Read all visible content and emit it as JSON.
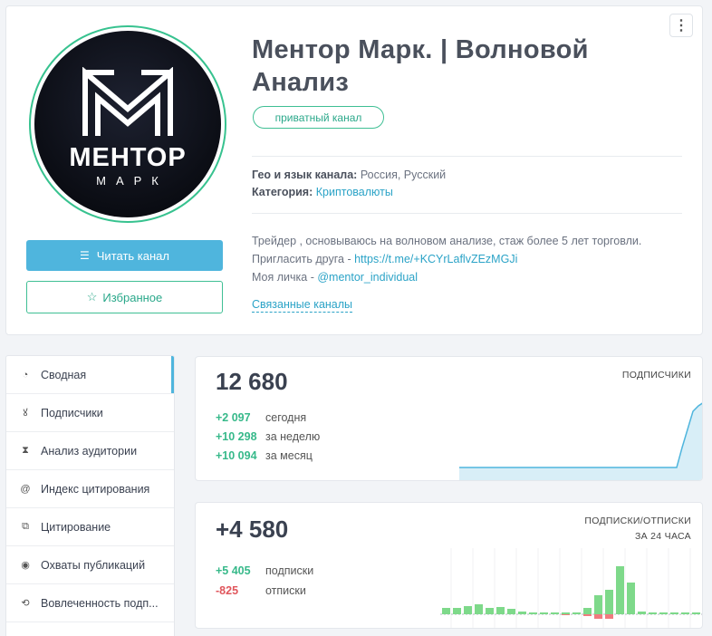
{
  "channel": {
    "title": "Ментор Марк. | Волновой Анализ",
    "badge": "приватный канал",
    "geo_label": "Гео и язык канала:",
    "geo_value": "Россия, Русский",
    "category_label": "Категория:",
    "category_value": "Криптовалюты",
    "desc_line1": "Трейдер , основываюсь на волновом анализе, стаж более 5 лет торговли.",
    "desc_line2_prefix": "Пригласить друга - ",
    "desc_line2_link": "https://t.me/+KCYrLaflvZEzMGJi",
    "desc_line3_prefix": "Моя личка - ",
    "desc_line3_link": "@mentor_individual",
    "related": "Связанные каналы",
    "logo_word": "МЕНТОР",
    "logo_sub": "МАРК"
  },
  "buttons": {
    "read": "Читать канал",
    "favorite": "Избранное",
    "menu_icon": "kebab-icon"
  },
  "sidebar": {
    "items": [
      {
        "label": "Сводная",
        "icon": "pie-icon",
        "active": true
      },
      {
        "label": "Подписчики",
        "icon": "users-icon"
      },
      {
        "label": "Анализ аудитории",
        "icon": "hourglass-icon"
      },
      {
        "label": "Индекс цитирования",
        "icon": "at-icon"
      },
      {
        "label": "Цитирование",
        "icon": "copy-icon"
      },
      {
        "label": "Охваты публикаций",
        "icon": "eye-icon"
      },
      {
        "label": "Вовлеченность подп...",
        "icon": "engagement-icon"
      }
    ]
  },
  "subscribers": {
    "total": "12 680",
    "label": "ПОДПИСЧИКИ",
    "rows": [
      {
        "value": "+2 097",
        "label": "сегодня"
      },
      {
        "value": "+10 298",
        "label": "за неделю"
      },
      {
        "value": "+10 094",
        "label": "за месяц"
      }
    ]
  },
  "subs_unsubs": {
    "total": "+4 580",
    "label1": "ПОДПИСКИ/ОТПИСКИ",
    "label2": "ЗА 24 ЧАСА",
    "rows": [
      {
        "value": "+5 405",
        "label": "подписки"
      },
      {
        "value": "-825",
        "label": "отписки"
      }
    ]
  },
  "colors": {
    "accent": "#4fb5dd",
    "green": "#37c28f",
    "red": "#e0565c"
  }
}
